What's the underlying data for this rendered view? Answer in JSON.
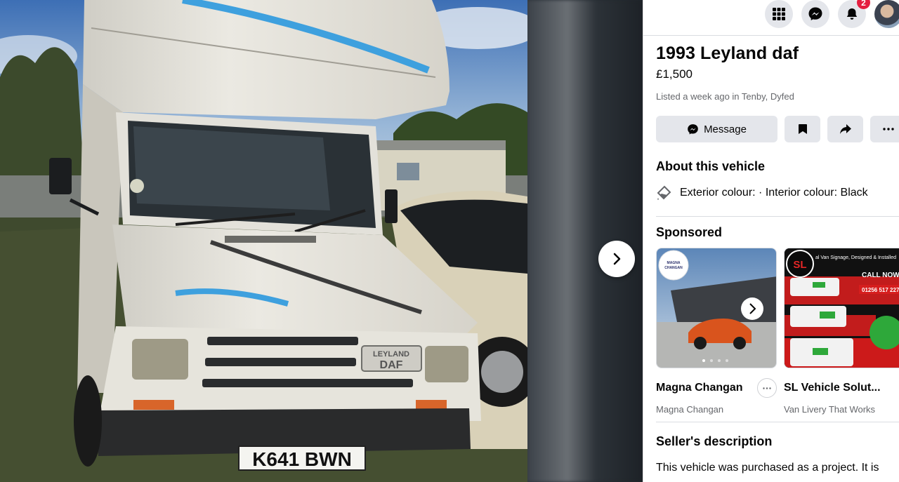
{
  "listing": {
    "title": "1993 Leyland daf",
    "price": "£1,500",
    "listed": "Listed a week ago in Tenby, Dyfed"
  },
  "photo": {
    "plate": "K641 BWN",
    "badge_line1": "LEYLAND",
    "badge_line2": "DAF"
  },
  "topbar": {
    "notifications_count": "2"
  },
  "actions": {
    "message_label": "Message"
  },
  "about": {
    "title": "About this vehicle",
    "colour_text": "Exterior colour: · Interior colour: Black"
  },
  "sponsored": {
    "title": "Sponsored",
    "ads": [
      {
        "name": "Magna Changan",
        "sub": "Magna Changan",
        "logo": "MAGNA CHANGAN"
      },
      {
        "name": "SL Vehicle Solut...",
        "sub": "Van Livery That Works",
        "banner": "al Van Signage, Designed & Installed",
        "cta": "CALL NOW",
        "phone": "01256 517 227",
        "logo": "SL"
      }
    ]
  },
  "description": {
    "title": "Seller's description",
    "text": "This vehicle was purchased as a project. It is"
  },
  "icons": {
    "grid": "grid-icon",
    "messenger": "messenger-icon",
    "bell": "bell-icon",
    "next": "chevron-right-icon",
    "bookmark": "bookmark-icon",
    "share": "share-icon",
    "more": "more-icon",
    "paint": "paint-icon"
  },
  "colors": {
    "accent_red": "#e41e3f",
    "button_grey": "#e4e6eb",
    "secondary_text": "#65676b"
  }
}
